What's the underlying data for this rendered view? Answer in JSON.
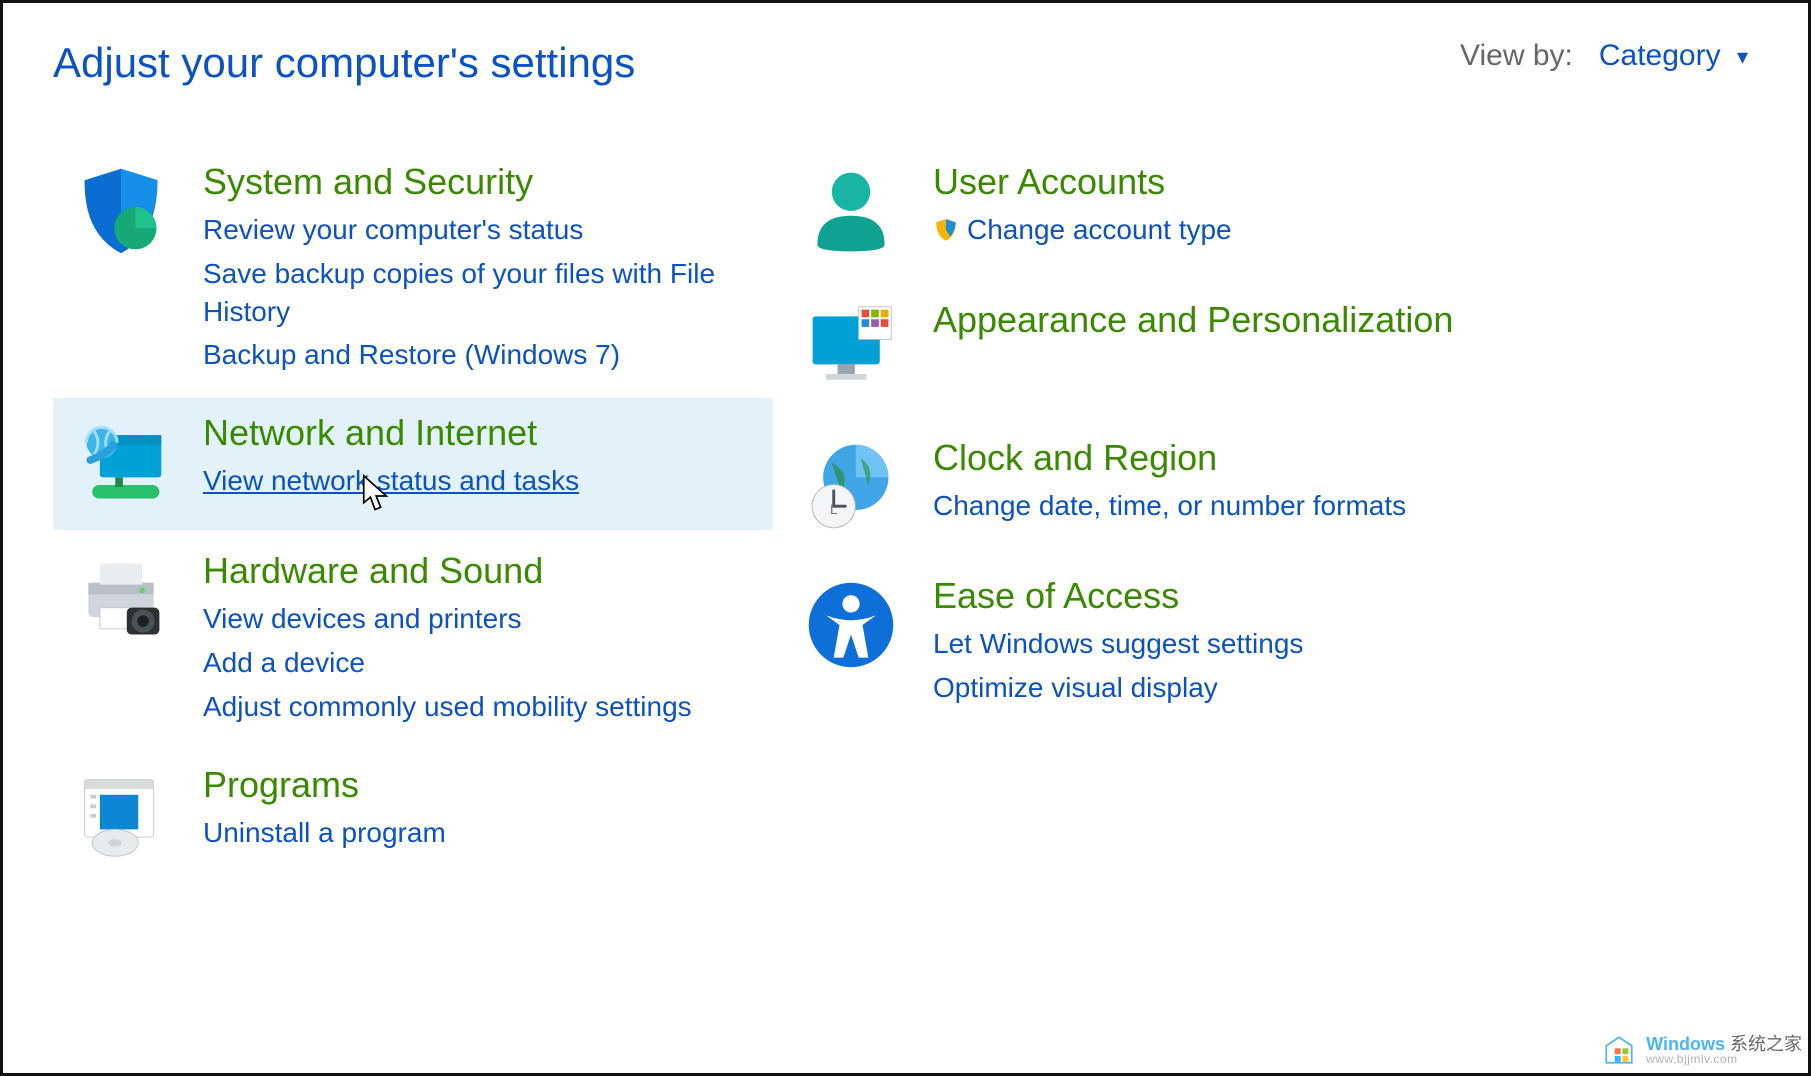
{
  "header": {
    "title": "Adjust your computer's settings",
    "view_by_label": "View by:",
    "view_by_value": "Category"
  },
  "left_categories": [
    {
      "icon": "shield-icon",
      "title": "System and Security",
      "links": [
        {
          "label": "Review your computer's status",
          "shield": false
        },
        {
          "label": "Save backup copies of your files with File History",
          "shield": false
        },
        {
          "label": "Backup and Restore (Windows 7)",
          "shield": false
        }
      ],
      "highlight": false
    },
    {
      "icon": "network-icon",
      "title": "Network and Internet",
      "links": [
        {
          "label": "View network status and tasks",
          "shield": false,
          "underlined": true
        }
      ],
      "highlight": true
    },
    {
      "icon": "printer-icon",
      "title": "Hardware and Sound",
      "links": [
        {
          "label": "View devices and printers",
          "shield": false
        },
        {
          "label": "Add a device",
          "shield": false
        },
        {
          "label": "Adjust commonly used mobility settings",
          "shield": false
        }
      ],
      "highlight": false
    },
    {
      "icon": "programs-icon",
      "title": "Programs",
      "links": [
        {
          "label": "Uninstall a program",
          "shield": false
        }
      ],
      "highlight": false
    }
  ],
  "right_categories": [
    {
      "icon": "user-icon",
      "title": "User Accounts",
      "links": [
        {
          "label": "Change account type",
          "shield": true
        }
      ],
      "highlight": false
    },
    {
      "icon": "appearance-icon",
      "title": "Appearance and Personalization",
      "links": [],
      "highlight": false
    },
    {
      "icon": "clock-icon",
      "title": "Clock and Region",
      "links": [
        {
          "label": "Change date, time, or number formats",
          "shield": false
        }
      ],
      "highlight": false
    },
    {
      "icon": "ease-icon",
      "title": "Ease of Access",
      "links": [
        {
          "label": "Let Windows suggest settings",
          "shield": false
        },
        {
          "label": "Optimize visual display",
          "shield": false
        }
      ],
      "highlight": false
    }
  ],
  "watermark": {
    "brand": "Windows",
    "suffix": "系统之家",
    "sub": "www.bjjmlv.com"
  }
}
